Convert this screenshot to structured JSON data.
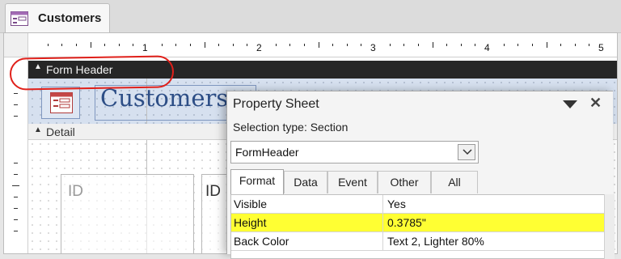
{
  "window": {
    "tab_title": "Customers",
    "tab_icon": "form-icon"
  },
  "ruler": {
    "numbers": [
      "1",
      "2",
      "3",
      "4",
      "5"
    ]
  },
  "form": {
    "header_section": "Form Header",
    "detail_section": "Detail",
    "title_label": "Customers",
    "logo_icon": "form-logo-icon",
    "id_textbox": "ID",
    "id_label": "ID"
  },
  "property_sheet": {
    "title": "Property Sheet",
    "selection_type": "Selection type:  Section",
    "selected_object": "FormHeader",
    "tabs": [
      "Format",
      "Data",
      "Event",
      "Other",
      "All"
    ],
    "active_tab": "Format",
    "properties": [
      {
        "name": "Visible",
        "value": "Yes"
      },
      {
        "name": "Height",
        "value": "0.3785\""
      },
      {
        "name": "Back Color",
        "value": "Text 2, Lighter 80%"
      }
    ],
    "highlighted_property": "Height"
  },
  "colors": {
    "form_header_bar": "#262626",
    "header_background": "#d6e0ef",
    "title_text": "#2d4e86",
    "annotation": "#e0201a",
    "highlight": "#ffff33"
  }
}
